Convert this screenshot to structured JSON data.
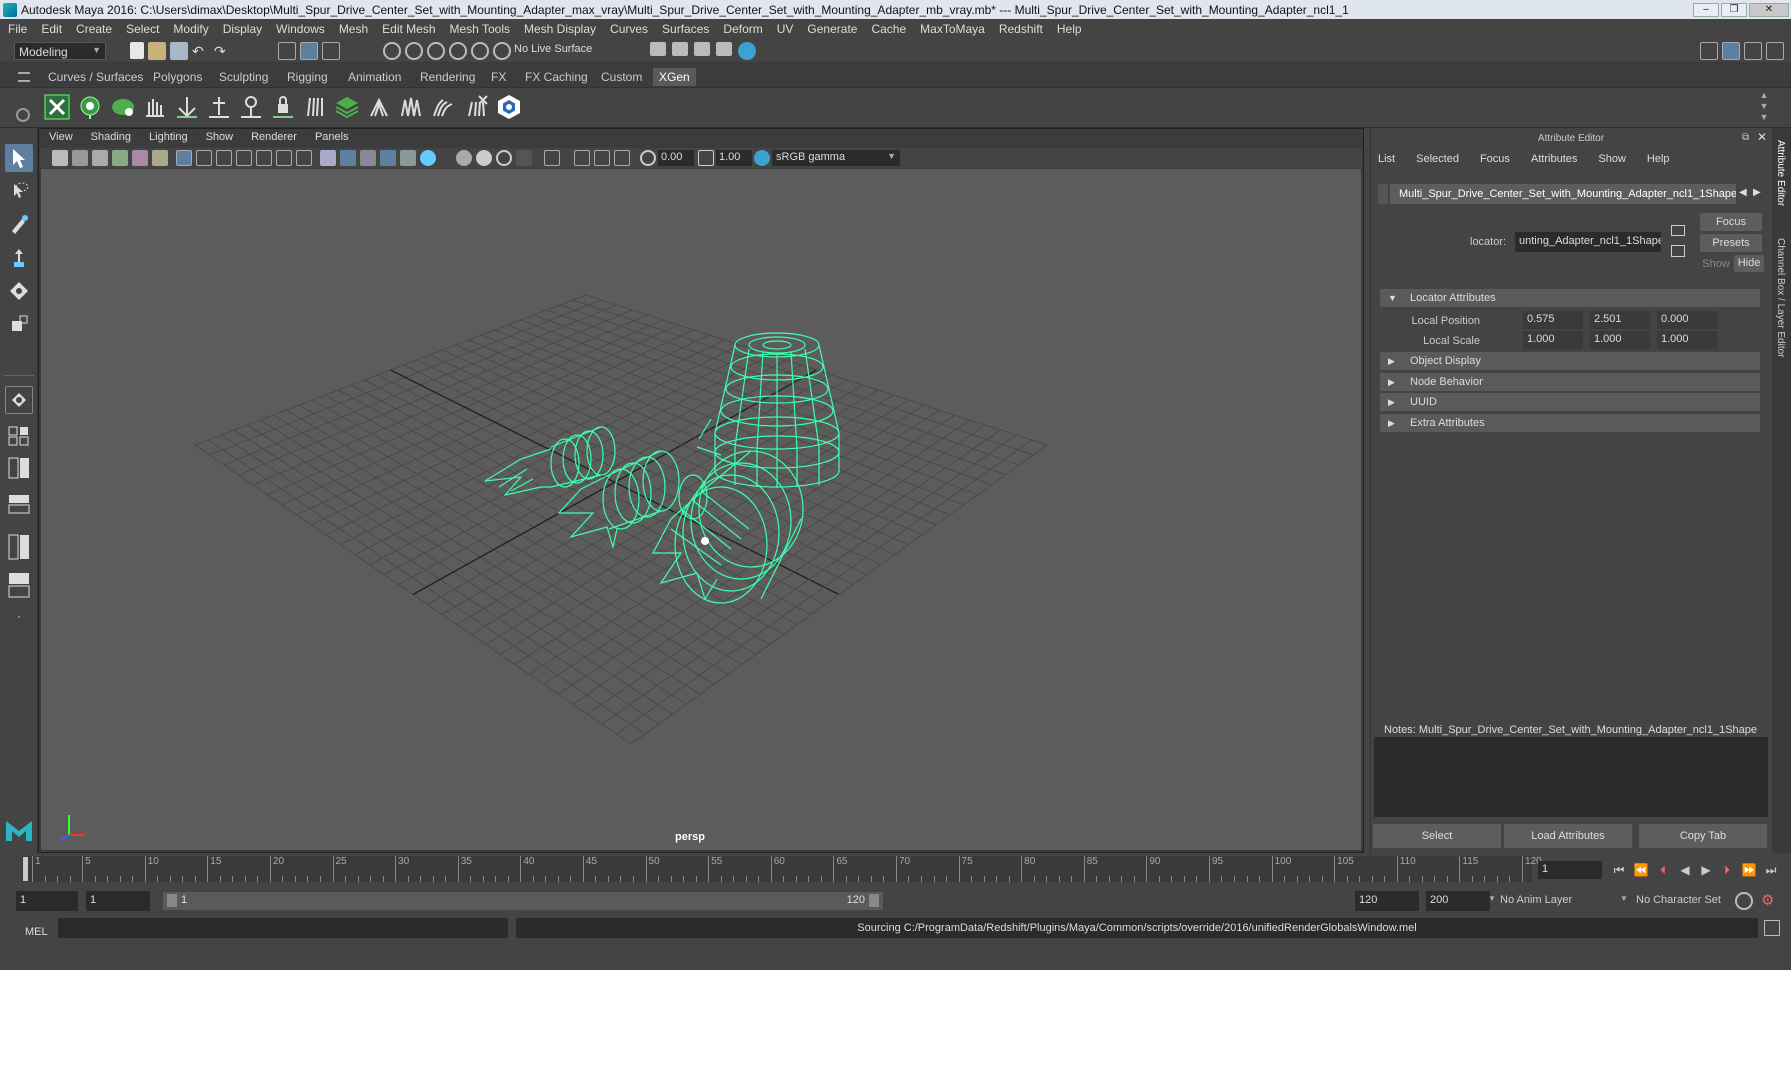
{
  "window": {
    "title": "Autodesk Maya 2016: C:\\Users\\dimax\\Desktop\\Multi_Spur_Drive_Center_Set_with_Mounting_Adapter_max_vray\\Multi_Spur_Drive_Center_Set_with_Mounting_Adapter_mb_vray.mb*  ---  Multi_Spur_Drive_Center_Set_with_Mounting_Adapter_ncl1_1",
    "minimize": "–",
    "maximize": "❐",
    "close": "✕"
  },
  "menubar": [
    "File",
    "Edit",
    "Create",
    "Select",
    "Modify",
    "Display",
    "Windows",
    "Mesh",
    "Edit Mesh",
    "Mesh Tools",
    "Mesh Display",
    "Curves",
    "Surfaces",
    "Deform",
    "UV",
    "Generate",
    "Cache",
    "MaxToMaya",
    "Redshift",
    "Help"
  ],
  "statusline": {
    "mode": "Modeling",
    "live_surface": "No Live Surface"
  },
  "shelf_tabs": [
    "Curves / Surfaces",
    "Polygons",
    "Sculpting",
    "Rigging",
    "Animation",
    "Rendering",
    "FX",
    "FX Caching",
    "Custom",
    "XGen"
  ],
  "active_shelf_tab": "XGen",
  "viewport": {
    "menu": [
      "View",
      "Shading",
      "Lighting",
      "Show",
      "Renderer",
      "Panels"
    ],
    "field1": "0.00",
    "field2": "1.00",
    "color_mgmt": "sRGB gamma",
    "camera": "persp",
    "wire_color": "#3dffb0"
  },
  "attribute_editor": {
    "title": "Attribute Editor",
    "menu": [
      "List",
      "Selected",
      "Focus",
      "Attributes",
      "Show",
      "Help"
    ],
    "node_tab": "Multi_Spur_Drive_Center_Set_with_Mounting_Adapter_ncl1_1Shape",
    "focus_btn": "Focus",
    "presets_btn": "Presets",
    "show_btn": "Show",
    "hide_btn": "Hide",
    "locator_label": "locator:",
    "locator_value": "unting_Adapter_ncl1_1Shape",
    "sections": [
      "Locator Attributes",
      "Object Display",
      "Node Behavior",
      "UUID",
      "Extra Attributes"
    ],
    "local_position": {
      "label": "Local Position",
      "values": [
        "0.575",
        "2.501",
        "0.000"
      ]
    },
    "local_scale": {
      "label": "Local Scale",
      "values": [
        "1.000",
        "1.000",
        "1.000"
      ]
    },
    "notes_label": "Notes:  Multi_Spur_Drive_Center_Set_with_Mounting_Adapter_ncl1_1Shape",
    "buttons": [
      "Select",
      "Load Attributes",
      "Copy Tab"
    ]
  },
  "side_tabs": [
    "Attribute Editor",
    "Channel Box / Layer Editor"
  ],
  "timeline": {
    "ticks": [
      "1",
      "5",
      "10",
      "15",
      "20",
      "25",
      "30",
      "35",
      "40",
      "45",
      "50",
      "55",
      "60",
      "65",
      "70",
      "75",
      "80",
      "85",
      "90",
      "95",
      "100",
      "105",
      "110",
      "115",
      "120"
    ],
    "current_frame": "1",
    "playback": [
      "⏮",
      "⏪",
      "⏴",
      "◀",
      "▶",
      "⏵",
      "⏩",
      "⏭"
    ]
  },
  "range": {
    "start": "1",
    "start2": "1",
    "bar_start": "1",
    "bar_end": "120",
    "end": "120",
    "end2": "200",
    "anim_layer": "No Anim Layer",
    "char_set": "No Character Set"
  },
  "command": {
    "lang": "MEL",
    "result": "Sourcing C:/ProgramData/Redshift/Plugins/Maya/Common/scripts/override/2016/unifiedRenderGlobalsWindow.mel"
  }
}
